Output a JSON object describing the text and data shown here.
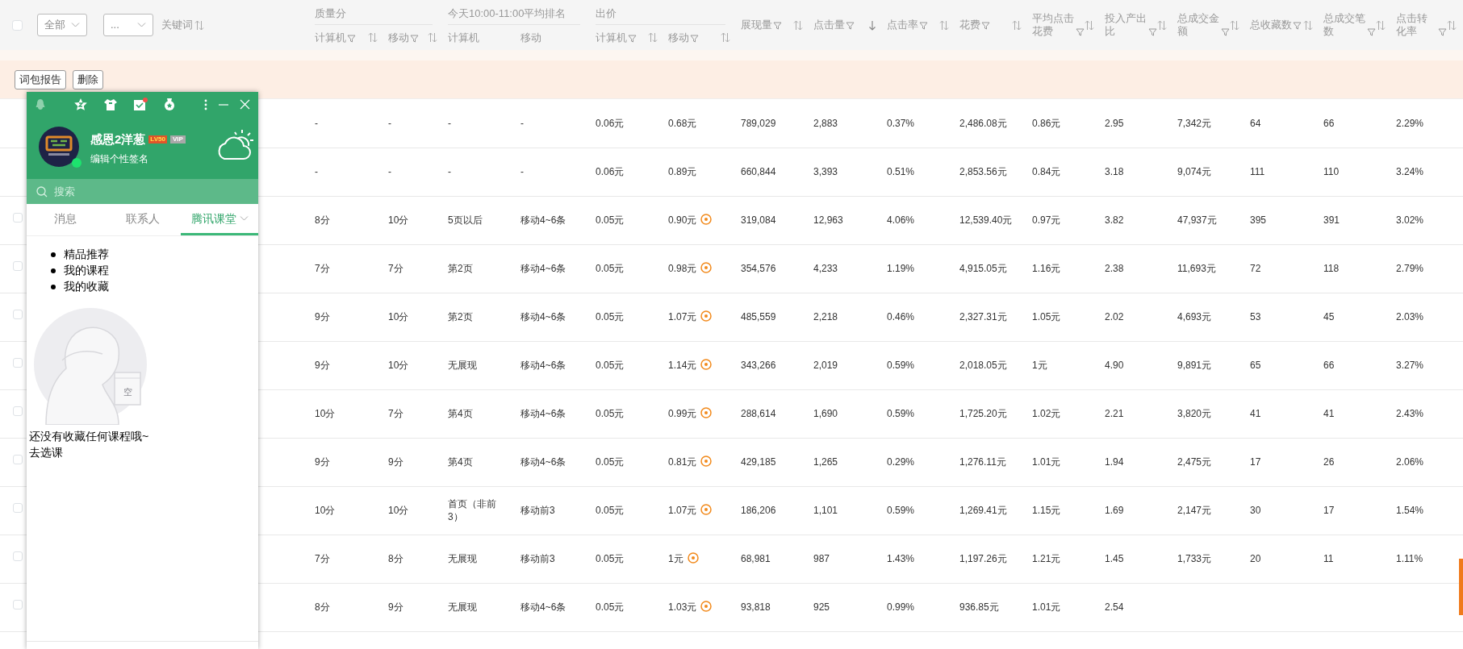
{
  "header": {
    "select_all": {
      "checked": false
    },
    "filters": [
      {
        "value": "全部"
      },
      {
        "value": "..."
      }
    ],
    "keyword_label": "关键词",
    "keyword_sortable": true
  },
  "column_groups": [
    {
      "label": "质量分",
      "columns": [
        {
          "label": "计算机",
          "filter": true,
          "sortable": true,
          "sorted": false
        },
        {
          "label": "移动",
          "filter": true,
          "sortable": true,
          "sorted": false
        }
      ]
    },
    {
      "label": "今天10:00-11:00平均排名",
      "columns": [
        {
          "label": "计算机",
          "filter": false,
          "sortable": false
        },
        {
          "label": "移动",
          "filter": false,
          "sortable": false
        }
      ]
    },
    {
      "label": "出价",
      "columns": [
        {
          "label": "计算机",
          "filter": true,
          "sortable": true,
          "sorted": false
        },
        {
          "label": "移动",
          "filter": true,
          "sortable": true,
          "sorted": false
        }
      ]
    }
  ],
  "columns": [
    {
      "label": "展现量",
      "filter": true,
      "sortable": true,
      "sorted": false
    },
    {
      "label": "点击量",
      "filter": true,
      "sortable": true,
      "sorted": true
    },
    {
      "label": "点击率",
      "filter": true,
      "sortable": true,
      "sorted": false
    },
    {
      "label": "花费",
      "filter": true,
      "sortable": true,
      "sorted": false
    },
    {
      "label": "平均点击花费",
      "filter": true,
      "sortable": true,
      "sorted": false
    },
    {
      "label": "投入产出比",
      "filter": true,
      "sortable": true,
      "sorted": false
    },
    {
      "label": "总成交金额",
      "filter": true,
      "sortable": true,
      "sorted": false
    },
    {
      "label": "总收藏数",
      "filter": true,
      "sortable": true,
      "sorted": false
    },
    {
      "label": "总成交笔数",
      "filter": true,
      "sortable": true,
      "sorted": false
    },
    {
      "label": "点击转化率",
      "filter": true,
      "sortable": true,
      "sorted": false
    }
  ],
  "actions": [
    "词包报告",
    "删除"
  ],
  "rows": [
    {
      "kind": "summary",
      "bid_icon": false,
      "cells": [
        "-",
        "-",
        "-",
        "-",
        "0.06元",
        "0.68元",
        "789,029",
        "2,883",
        "0.37%",
        "2,486.08元",
        "0.86元",
        "2.95",
        "7,342元",
        "64",
        "66",
        "2.29%"
      ]
    },
    {
      "kind": "summary",
      "bid_icon": false,
      "cells": [
        "-",
        "-",
        "-",
        "-",
        "0.06元",
        "0.89元",
        "660,844",
        "3,393",
        "0.51%",
        "2,853.56元",
        "0.84元",
        "3.18",
        "9,074元",
        "111",
        "110",
        "3.24%"
      ]
    },
    {
      "kind": "keyword",
      "checked": false,
      "bid_icon": true,
      "cells": [
        "8分",
        "10分",
        "5页以后",
        "移动4~6条",
        "0.05元",
        "0.90元",
        "319,084",
        "12,963",
        "4.06%",
        "12,539.40元",
        "0.97元",
        "3.82",
        "47,937元",
        "395",
        "391",
        "3.02%"
      ]
    },
    {
      "kind": "keyword",
      "checked": false,
      "bid_icon": true,
      "cells": [
        "7分",
        "7分",
        "第2页",
        "移动4~6条",
        "0.05元",
        "0.98元",
        "354,576",
        "4,233",
        "1.19%",
        "4,915.05元",
        "1.16元",
        "2.38",
        "11,693元",
        "72",
        "118",
        "2.79%"
      ]
    },
    {
      "kind": "keyword",
      "checked": false,
      "bid_icon": true,
      "cells": [
        "9分",
        "10分",
        "第2页",
        "移动4~6条",
        "0.05元",
        "1.07元",
        "485,559",
        "2,218",
        "0.46%",
        "2,327.31元",
        "1.05元",
        "2.02",
        "4,693元",
        "53",
        "45",
        "2.03%"
      ]
    },
    {
      "kind": "keyword",
      "checked": false,
      "bid_icon": true,
      "cells": [
        "9分",
        "10分",
        "无展现",
        "移动4~6条",
        "0.05元",
        "1.14元",
        "343,266",
        "2,019",
        "0.59%",
        "2,018.05元",
        "1元",
        "4.90",
        "9,891元",
        "65",
        "66",
        "3.27%"
      ]
    },
    {
      "kind": "keyword",
      "checked": false,
      "bid_icon": true,
      "cells": [
        "10分",
        "7分",
        "第4页",
        "移动4~6条",
        "0.05元",
        "0.99元",
        "288,614",
        "1,690",
        "0.59%",
        "1,725.20元",
        "1.02元",
        "2.21",
        "3,820元",
        "41",
        "41",
        "2.43%"
      ]
    },
    {
      "kind": "keyword",
      "checked": false,
      "bid_icon": true,
      "cells": [
        "9分",
        "9分",
        "第4页",
        "移动4~6条",
        "0.05元",
        "0.81元",
        "429,185",
        "1,265",
        "0.29%",
        "1,276.11元",
        "1.01元",
        "1.94",
        "2,475元",
        "17",
        "26",
        "2.06%"
      ]
    },
    {
      "kind": "keyword",
      "checked": false,
      "bid_icon": true,
      "cells": [
        "10分",
        "10分",
        "首页（非前3）",
        "移动前3",
        "0.05元",
        "1.07元",
        "186,206",
        "1,101",
        "0.59%",
        "1,269.41元",
        "1.15元",
        "1.69",
        "2,147元",
        "30",
        "17",
        "1.54%"
      ]
    },
    {
      "kind": "keyword",
      "checked": false,
      "bid_icon": true,
      "cells": [
        "7分",
        "8分",
        "无展现",
        "移动前3",
        "0.05元",
        "1元",
        "68,981",
        "987",
        "1.43%",
        "1,197.26元",
        "1.21元",
        "1.45",
        "1,733元",
        "20",
        "11",
        "1.11%"
      ]
    },
    {
      "kind": "keyword",
      "checked": false,
      "bid_icon": true,
      "cells": [
        "8分",
        "9分",
        "无展现",
        "移动4~6条",
        "0.05元",
        "1.03元",
        "93,818",
        "925",
        "0.99%",
        "936.85元",
        "1.01元",
        "2.54"
      ]
    }
  ],
  "qq_window": {
    "notification_dot": true,
    "profile": {
      "name": "感恩2洋葱",
      "level_badge": "LV50",
      "vip_badge": "VIP",
      "signature": "编辑个性签名",
      "online": true
    },
    "search": {
      "placeholder": "搜索"
    },
    "tabs": [
      {
        "label": "消息",
        "selected": false,
        "dropdown": false
      },
      {
        "label": "联系人",
        "selected": false,
        "dropdown": false
      },
      {
        "label": "腾讯课堂",
        "selected": true,
        "dropdown": true
      }
    ],
    "menu": [
      "精品推荐",
      "我的课程",
      "我的收藏"
    ],
    "illustration_label": "空",
    "empty_message": "还没有收藏任何课程哦~",
    "link": "去选课"
  }
}
